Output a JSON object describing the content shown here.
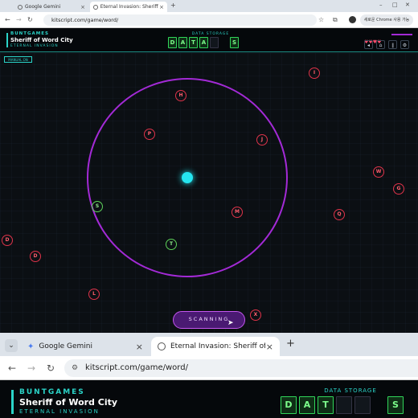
{
  "browser_top": {
    "tabs": [
      {
        "label": "Google Gemini",
        "active": false
      },
      {
        "label": "Eternal Invasion: Sheriff of W…",
        "active": true
      }
    ],
    "new_tab": "+",
    "url": "kitscript.com/game/word/",
    "profile_label": "새로운 Chrome 사용 가능",
    "window_controls": [
      "–",
      "□",
      "✕"
    ]
  },
  "game": {
    "brand": "BUNTGAMES",
    "title": "Sheriff of Word City",
    "subtitle": "ETERNAL INVASION",
    "data_storage_label": "DATA STORAGE",
    "slots": [
      "D",
      "A",
      "T",
      "A",
      "",
      "S"
    ],
    "hearts": 4,
    "manual_button": "MANUAL ON",
    "scan_button": "SCANNING",
    "letters": [
      {
        "char": "I",
        "captured": false
      },
      {
        "char": "H",
        "captured": false
      },
      {
        "char": "P",
        "captured": false
      },
      {
        "char": "J",
        "captured": false
      },
      {
        "char": "W",
        "captured": false
      },
      {
        "char": "G",
        "captured": false
      },
      {
        "char": "S",
        "captured": true
      },
      {
        "char": "M",
        "captured": false
      },
      {
        "char": "Q",
        "captured": false
      },
      {
        "char": "D",
        "captured": false
      },
      {
        "char": "D",
        "captured": false
      },
      {
        "char": "T",
        "captured": true
      },
      {
        "char": "L",
        "captured": false
      },
      {
        "char": "X",
        "captured": false
      }
    ]
  },
  "browser_zoom": {
    "tabs": [
      {
        "label": "Google Gemini",
        "active": false
      },
      {
        "label": "Eternal Invasion: Sheriff of W",
        "active": true
      }
    ],
    "new_tab": "+",
    "url": "kitscript.com/game/word/",
    "brand": "BUNTGAMES",
    "title": "Sheriff of Word City",
    "subtitle": "ETERNAL INVASION",
    "data_storage_label": "DATA STORAGE",
    "slots": [
      "D",
      "A",
      "T",
      "",
      "",
      "S"
    ]
  },
  "colors": {
    "accent": "#2bd4c8",
    "radar": "#a32ad6",
    "enemy": "#e0334a",
    "captured": "#5fd35a",
    "core": "#25e6f0"
  }
}
